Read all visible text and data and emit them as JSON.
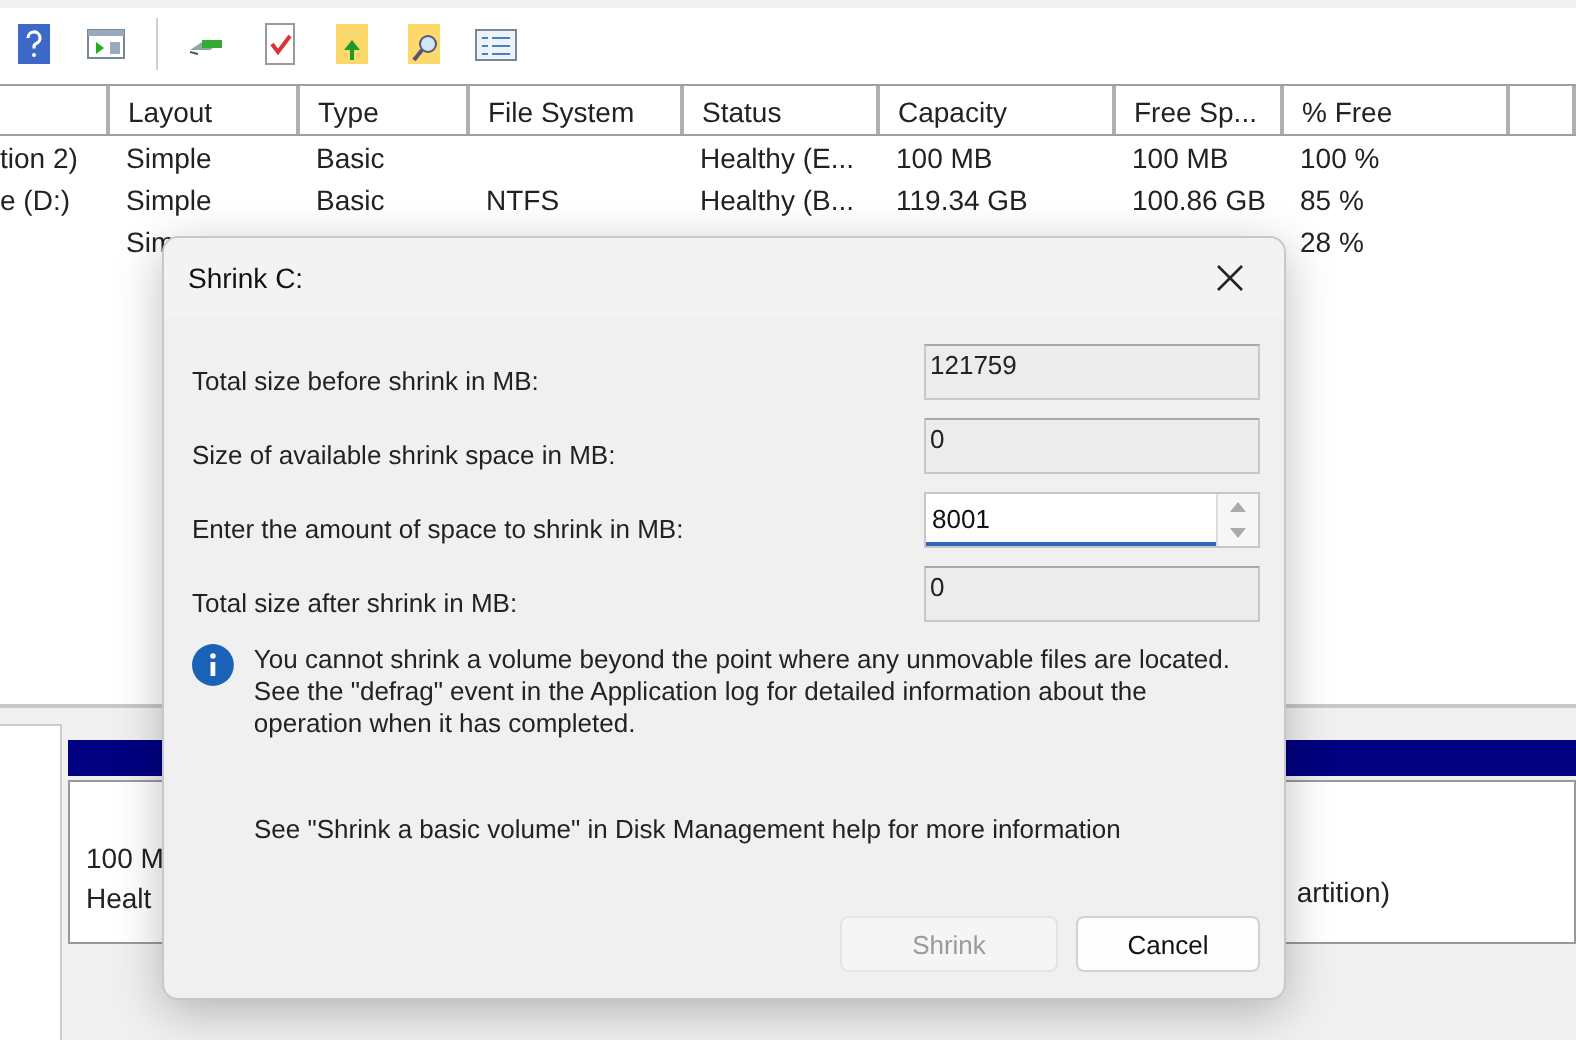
{
  "toolbar": [
    {
      "kind": "help"
    },
    {
      "kind": "panel"
    },
    {
      "kind": "connect"
    },
    {
      "kind": "check"
    },
    {
      "kind": "folder-up"
    },
    {
      "kind": "folder-search"
    },
    {
      "kind": "list"
    }
  ],
  "table": {
    "columns": [
      "",
      "Layout",
      "Type",
      "File System",
      "Status",
      "Capacity",
      "Free Sp...",
      "% Free",
      ""
    ],
    "rows": [
      {
        "cells": [
          "tion 2)",
          "Simple",
          "Basic",
          "",
          "Healthy (E...",
          "100 MB",
          "100 MB",
          "100 %",
          ""
        ]
      },
      {
        "cells": [
          "e (D:)",
          "Simple",
          "Basic",
          "NTFS",
          "Healthy (B...",
          "119.34 GB",
          "100.86 GB",
          "85 %",
          ""
        ]
      },
      {
        "cells": [
          "",
          "Sim",
          "",
          "",
          "",
          "",
          "",
          "28 %",
          ""
        ]
      }
    ]
  },
  "disk_panel": {
    "partition_lines": [
      "100 M",
      "Healt"
    ],
    "right_text": "artition)"
  },
  "dialog": {
    "title": "Shrink C:",
    "fields": [
      {
        "label": "Total size before shrink in MB:",
        "value": "121759",
        "kind": "readonly"
      },
      {
        "label": "Size of available shrink space in MB:",
        "value": "0",
        "kind": "readonly"
      },
      {
        "label": "Enter the amount of space to shrink in MB:",
        "value": "8001",
        "kind": "spin"
      },
      {
        "label": "Total size after shrink in MB:",
        "value": "0",
        "kind": "readonly"
      }
    ],
    "info": "You cannot shrink a volume beyond the point where any unmovable files are located. See the \"defrag\" event in the Application log for detailed information about the operation when it has completed.",
    "help": "See \"Shrink a basic volume\" in Disk Management help for more information",
    "buttons": [
      {
        "label": "Shrink",
        "disabled": true
      },
      {
        "label": "Cancel",
        "disabled": false
      }
    ]
  }
}
